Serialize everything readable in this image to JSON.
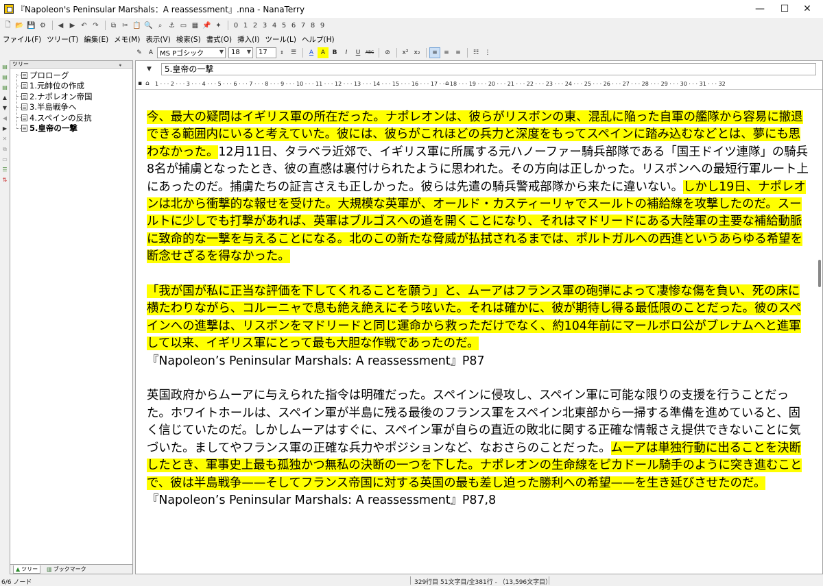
{
  "window": {
    "title": "『Napoleon's Peninsular Marshals：A reassessment』.nna - NanaTerry",
    "minimize": "—",
    "maximize": "☐",
    "close": "✕"
  },
  "toolbar_numbers": [
    "0",
    "1",
    "2",
    "3",
    "4",
    "5",
    "6",
    "7",
    "8",
    "9"
  ],
  "menu": [
    "ファイル(F)",
    "ツリー(T)",
    "編集(E)",
    "メモ(M)",
    "表示(V)",
    "検索(S)",
    "書式(O)",
    "挿入(I)",
    "ツール(L)",
    "ヘルプ(H)"
  ],
  "format": {
    "font_name": "MS Pゴシック",
    "font_size": "18",
    "line_spacing": "17",
    "buttons": [
      "A",
      "A",
      "B",
      "I",
      "U",
      "ABC",
      "x²",
      "x₂"
    ]
  },
  "tree": {
    "header": "ツリー",
    "pin": "ᵩ",
    "items": [
      {
        "label": "プロローグ"
      },
      {
        "label": "1.元帥位の作成"
      },
      {
        "label": "2.ナポレオン帝国"
      },
      {
        "label": "3.半島戦争へ"
      },
      {
        "label": "4.スペインの反抗"
      },
      {
        "label": "5.皇帝の一撃"
      }
    ],
    "tabs": [
      "ツリー",
      "ブックマーク"
    ]
  },
  "editor": {
    "heading": "5.皇帝の一撃",
    "ruler_text": "1 · · · 2 · · · 3 · · · 4 · · · 5 · · · 6 · · · 7 · · · 8 · · · 9 · · · 10 · · · 11 · · · 12 · · · 13 · · · 14 · · · 15 · · · 16 · · · 17 · · · 18 · · · 19 · · · 20 · · · 21 · · · 22 · · · 23 · · · 24 · · · 25 · · · 26 · · · 27 · · · 28 · · · 29 · · · 30 · · · 31 · · · 32",
    "p1_a": "今、最大の疑問はイギリス軍の所在だった。ナポレオンは、彼らがリスボンの東、混乱に陥った自軍の艦隊から容易に撤退できる範囲内にいると考えていた。彼には、彼らがこれほどの兵力と深度をもってスペインに踏み込むなどとは、夢にも思わなかった。",
    "p1_b": "12月11日、タラベラ近郊で、イギリス軍に所属する元ハノーファー騎兵部隊である「国王ドイツ連隊」の騎兵8名が捕虜となったとき、彼の直感は裏付けられたように思われた。その方向は正しかった。リスボンへの最短行軍ルート上にあったのだ。捕虜たちの証言さえも正しかった。彼らは先遣の騎兵警戒部隊から来たに違いない。",
    "p1_c": "しかし19日、ナポレオンは北から衝撃的な報せを受けた。大規模な英軍が、オールド・カスティーリャでスールトの補給線を攻撃したのだ。スールトに少しでも打撃があれば、英軍はブルゴスへの道を開くことになり、それはマドリードにある大陸軍の主要な補給動脈に致命的な一撃を与えることになる。北のこの新たな脅威が払拭されるまでは、ポルトガルへの西進というあらゆる希望を断念せざるを得なかった。",
    "p2": "「我が国が私に正当な評価を下してくれることを願う」と、ムーアはフランス軍の砲弾によって凄惨な傷を負い、死の床に横たわりながら、コルーニャで息も絶え絶えにそう呟いた。それは確かに、彼が期待し得る最低限のことだった。彼のスペインへの進撃は、リスボンをマドリードと同じ運命から救っただけでなく、約104年前にマールボロ公がブレナムへと進軍して以来、イギリス軍にとって最も大胆な作戦であったのだ。",
    "cite1": "『Napoleon’s Peninsular Marshals: A reassessment』P87",
    "p3_a": "英国政府からムーアに与えられた指令は明確だった。スペインに侵攻し、スペイン軍に可能な限りの支援を行うことだった。ホワイトホールは、スペイン軍が半島に残る最後のフランス軍をスペイン北東部から一掃する準備を進めていると、固く信じていたのだ。しかしムーアはすぐに、スペイン軍が自らの直近の敗北に関する正確な情報さえ提供できないことに気づいた。ましてやフランス軍の正確な兵力やポジションなど、なおさらのことだった。",
    "p3_b": "ムーアは単独行動に出ることを決断したとき、軍事史上最も孤独かつ無私の決断の一つを下した。ナポレオンの生命線をピカドール騎手のように突き進むことで、彼は半島戦争——そしてフランス帝国に対する英国の最も差し迫った勝利への希望——を生き延びさせたのだ。",
    "cite2": "『Napoleon’s Peninsular Marshals: A reassessment』P87,8"
  },
  "status": {
    "left": "6/6 ノード",
    "right": "329行目 51文字目/全381行 - （13,596文字目）"
  },
  "colors": {
    "highlight": "#ffff00"
  }
}
